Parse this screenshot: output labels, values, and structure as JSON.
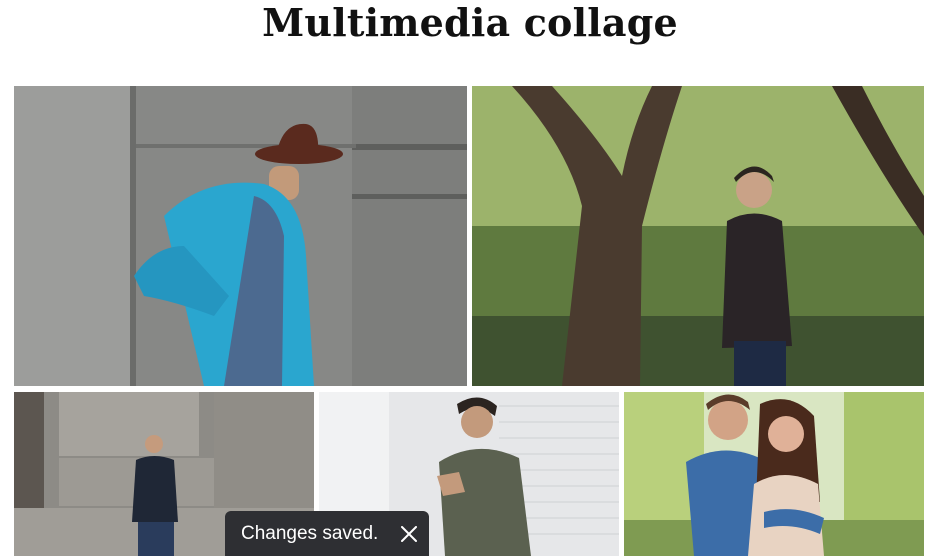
{
  "page": {
    "title": "Multimedia collage"
  },
  "gallery": {
    "photos": [
      {
        "subject": "man in blue blazer and brown hat beside concrete wall"
      },
      {
        "subject": "man in black turtleneck among trees"
      },
      {
        "subject": "man in dark sweater between stone blocks"
      },
      {
        "subject": "man with glasses against white brick wall"
      },
      {
        "subject": "smiling couple embracing outdoors"
      }
    ]
  },
  "toast": {
    "message": "Changes saved.",
    "close_icon": "close-icon"
  },
  "colors": {
    "toast_bg": "#2e2f33",
    "toast_text": "#ffffff"
  }
}
